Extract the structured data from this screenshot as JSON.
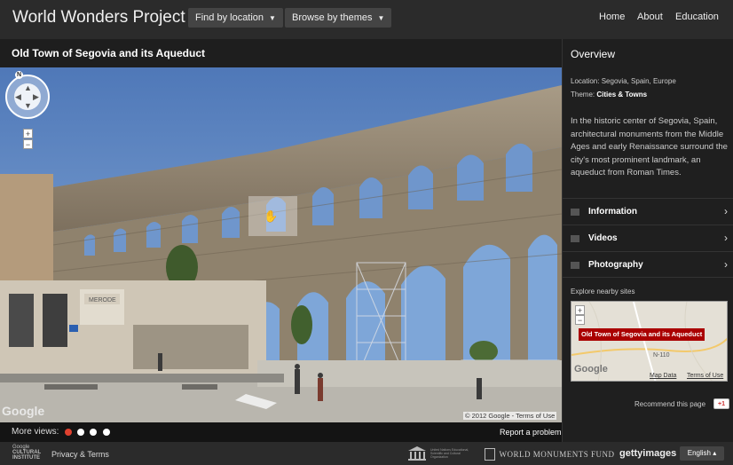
{
  "header": {
    "logo": "World Wonders Project",
    "find_by_location": "Find by location",
    "browse_by_themes": "Browse by themes",
    "links": [
      "Home",
      "About",
      "Education"
    ]
  },
  "viewer": {
    "title": "Old Town of Segovia and its Aqueduct",
    "compass_letter": "N",
    "zoom_in": "+",
    "zoom_out": "−",
    "google_logo": "Google",
    "copyright": "© 2012 Google - Terms of Use",
    "shop_sign": "MERODE"
  },
  "more_views": {
    "label": "More views:",
    "dot_count": 4,
    "active_dot_color": "#e0412f",
    "report": "Report a problem"
  },
  "sidebar": {
    "title": "Overview",
    "location_label": "Location:",
    "location_value": "Segovia, Spain, Europe",
    "theme_label": "Theme:",
    "theme_value": "Cities & Towns",
    "description": "In the historic center of Segovia, Spain, architectural monuments from the Middle Ages and early Renaissance surround the city's most prominent landmark, an aqueduct from Roman Times.",
    "sections": [
      {
        "label": "Information",
        "icon": "list-icon"
      },
      {
        "label": "Videos",
        "icon": "film-icon"
      },
      {
        "label": "Photography",
        "icon": "camera-icon"
      }
    ],
    "nearby_label": "Explore nearby sites",
    "map_marker_label": "Old Town of Segovia and its Aqueduct",
    "map_google": "Google",
    "map_data": "Map Data",
    "map_terms": "Terms of Use",
    "map_road": "N-110",
    "recommend": "Recommend this page",
    "plus_one": "+1"
  },
  "footer": {
    "brand_line1": "Google",
    "brand_line2": "CULTURAL",
    "brand_line3": "INSTITUTE",
    "privacy": "Privacy & Terms",
    "unesco_text": "United Nations Educational, Scientific and Cultural Organization",
    "wmf": "WORLD MONUMENTS FUND",
    "getty": "gettyimages",
    "language": "English ▴"
  }
}
